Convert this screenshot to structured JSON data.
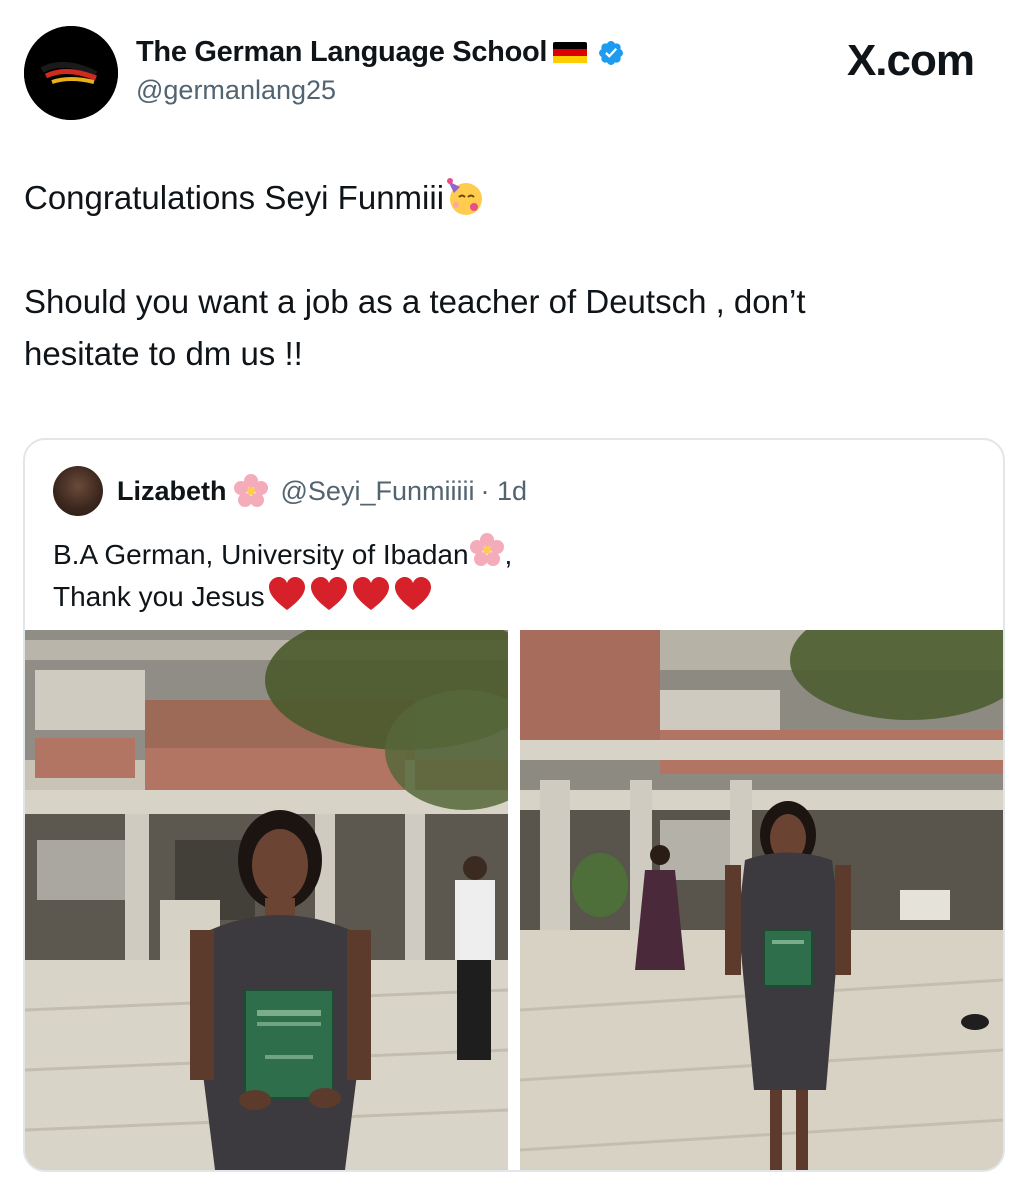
{
  "header": {
    "display_name": "The German Language School",
    "handle": "@germanlang25",
    "brand": "X.com"
  },
  "tweet": {
    "line1": "Congratulations Seyi Funmiii",
    "line2": "Should you want a job as a teacher of Deutsch , don’t",
    "line3": "hesitate to dm us !!"
  },
  "quote": {
    "name": "Lizabeth",
    "handle": "@Seyi_Funmiiiii",
    "time": "· 1d",
    "line1": "B.A German, University of Ibadan",
    "line1_suffix": ",",
    "line2": "Thank you Jesus",
    "hearts": 4
  },
  "colors": {
    "verified": "#1d9bf0",
    "handle": "#536471",
    "border": "#e1e6ea",
    "heart": "#d6202a"
  },
  "icons": {
    "verified": "verified-badge-icon",
    "flag": "germany-flag-icon",
    "party": "partying-face-emoji",
    "blossom": "cherry-blossom-emoji",
    "heart": "red-heart-emoji"
  }
}
